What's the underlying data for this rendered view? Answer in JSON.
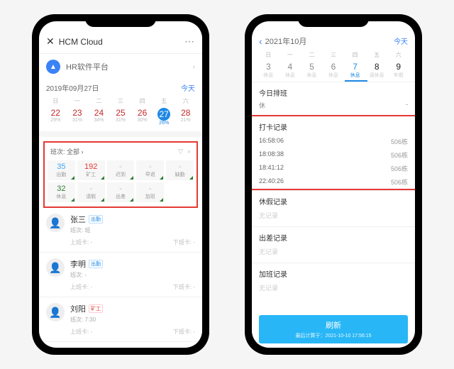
{
  "phone1": {
    "nav": {
      "title": "HCM Cloud"
    },
    "org": {
      "name": "HR软件平台"
    },
    "dateRow": {
      "date": "2019年09月27日",
      "today": "今天"
    },
    "weekdays": [
      "日",
      "一",
      "二",
      "三",
      "四",
      "五",
      "六"
    ],
    "days": [
      {
        "num": "22",
        "pct": "29%"
      },
      {
        "num": "23",
        "pct": "31%"
      },
      {
        "num": "24",
        "pct": "34%"
      },
      {
        "num": "25",
        "pct": "31%"
      },
      {
        "num": "26",
        "pct": "30%"
      },
      {
        "num": "27",
        "pct": "26%",
        "sel": true
      },
      {
        "num": "28",
        "pct": "21%"
      }
    ],
    "filter": {
      "label": "班次: 全部",
      "chev": "›"
    },
    "stats": [
      {
        "v": "35",
        "l": "出勤",
        "cls": ""
      },
      {
        "v": "192",
        "l": "矿工",
        "cls": "red"
      },
      {
        "v": "-",
        "l": "迟到",
        "cls": "dash"
      },
      {
        "v": "-",
        "l": "早退",
        "cls": "dash"
      },
      {
        "v": "-",
        "l": "缺勤",
        "cls": "dash"
      },
      {
        "v": "32",
        "l": "休息",
        "cls": "green"
      },
      {
        "v": "-",
        "l": "请假",
        "cls": "dash"
      },
      {
        "v": "-",
        "l": "出差",
        "cls": "dash"
      },
      {
        "v": "-",
        "l": "加班",
        "cls": "dash"
      }
    ],
    "people": [
      {
        "name": "张三",
        "tag": "出勤",
        "tagcls": "",
        "sub": "班次: 班",
        "in": "上班卡: -",
        "out": "下班卡: -"
      },
      {
        "name": "李明",
        "tag": "出勤",
        "tagcls": "",
        "sub": "班次: -",
        "in": "上班卡: -",
        "out": "下班卡: -"
      },
      {
        "name": "刘阳",
        "tag": "矿工",
        "tagcls": "red",
        "sub": "班次: 7:30",
        "in": "上班卡: -",
        "out": "下班卡: -"
      }
    ]
  },
  "phone2": {
    "nav": {
      "date": "2021年10月",
      "today": "今天"
    },
    "weekdays": [
      "日",
      "一",
      "二",
      "三",
      "四",
      "五",
      "六"
    ],
    "days": [
      {
        "num": "3",
        "lab": "休息"
      },
      {
        "num": "4",
        "lab": "休息"
      },
      {
        "num": "5",
        "lab": "休息"
      },
      {
        "num": "6",
        "lab": "休息"
      },
      {
        "num": "7",
        "lab": "休息",
        "sel": true
      },
      {
        "num": "8",
        "lab": "调休息",
        "dark": true
      },
      {
        "num": "9",
        "lab": "年假",
        "dark": true
      }
    ],
    "schedule": {
      "title": "今日排班",
      "shift": "休",
      "val": "-"
    },
    "punch": {
      "title": "打卡记录",
      "rows": [
        {
          "t": "16:58:06",
          "loc": "506栋"
        },
        {
          "t": "18:08:38",
          "loc": "506栋"
        },
        {
          "t": "18:41:12",
          "loc": "506栋"
        },
        {
          "t": "22:40:26",
          "loc": "506栋"
        }
      ]
    },
    "leave": {
      "title": "休假记录",
      "empty": "无记录"
    },
    "trip": {
      "title": "出差记录",
      "empty": "无记录"
    },
    "ot": {
      "title": "加班记录",
      "empty": "无记录"
    },
    "refresh": {
      "label": "刷新",
      "sub": "最后计算于：2021-10-10 17:56:15"
    }
  }
}
